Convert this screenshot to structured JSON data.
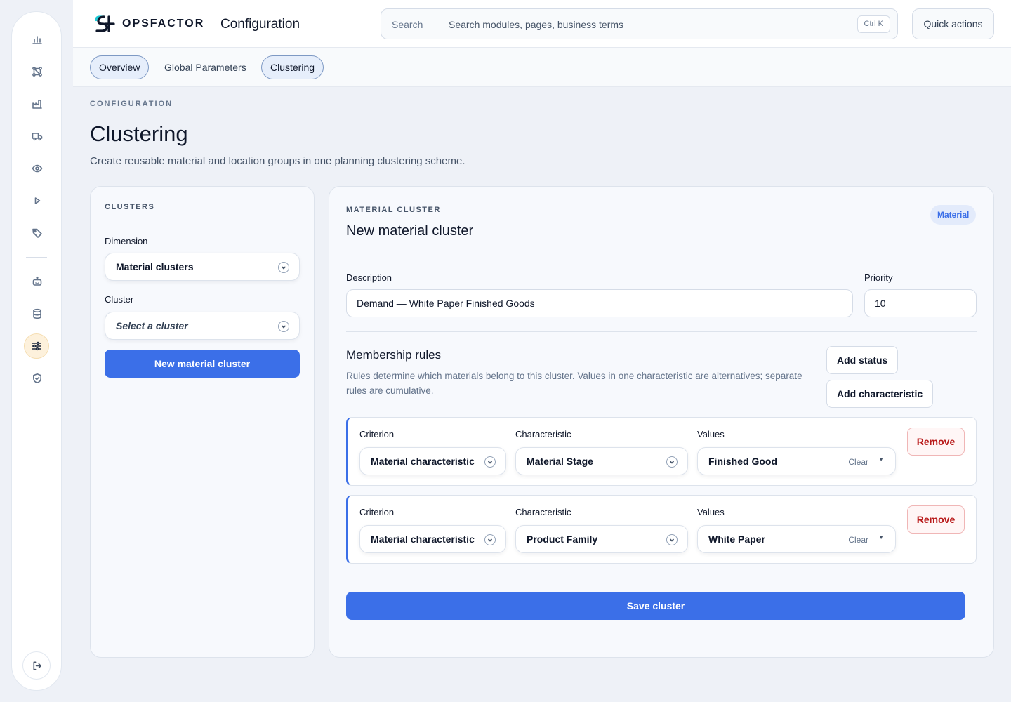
{
  "brand": {
    "name": "OPSFACTOR",
    "app_title": "Configuration"
  },
  "search": {
    "label": "Search",
    "placeholder": "Search modules, pages, business terms",
    "shortcut": "Ctrl K"
  },
  "quick_actions": "Quick actions",
  "tabs": [
    {
      "label": "Overview",
      "style": "pill"
    },
    {
      "label": "Global Parameters",
      "style": "plain"
    },
    {
      "label": "Clustering",
      "style": "pill"
    }
  ],
  "header": {
    "eyebrow": "CONFIGURATION",
    "title": "Clustering",
    "subtitle": "Create reusable material and location groups in one planning clustering scheme."
  },
  "sidebar_icons": [
    "bar-chart-icon",
    "network-icon",
    "factory-icon",
    "truck-icon",
    "eye-icon",
    "play-icon",
    "tag-icon",
    "robot-icon",
    "database-icon",
    "sliders-icon",
    "shield-check-icon",
    "logout-icon"
  ],
  "clusters_panel": {
    "heading": "CLUSTERS",
    "dimension_label": "Dimension",
    "dimension_value": "Material clusters",
    "cluster_label": "Cluster",
    "cluster_placeholder": "Select a cluster",
    "new_button": "New material cluster"
  },
  "editor": {
    "eyebrow": "MATERIAL CLUSTER",
    "title": "New material cluster",
    "badge": "Material",
    "description_label": "Description",
    "description_value": "Demand — White Paper Finished Goods",
    "priority_label": "Priority",
    "priority_value": "10",
    "rules_title": "Membership rules",
    "rules_help": "Rules determine which materials belong to this cluster. Values in one characteristic are alternatives; separate rules are cumulative.",
    "add_status": "Add status",
    "add_characteristic": "Add characteristic",
    "col_criterion": "Criterion",
    "col_characteristic": "Characteristic",
    "col_values": "Values",
    "clear_label": "Clear",
    "remove_label": "Remove",
    "rules": [
      {
        "criterion": "Material characteristic",
        "characteristic": "Material Stage",
        "values": "Finished Good"
      },
      {
        "criterion": "Material characteristic",
        "characteristic": "Product Family",
        "values": "White Paper"
      }
    ],
    "save_button": "Save cluster"
  },
  "colors": {
    "accent": "#3b6fe8",
    "active_nav": "#fdf1dc",
    "danger": "#b91c1c"
  }
}
